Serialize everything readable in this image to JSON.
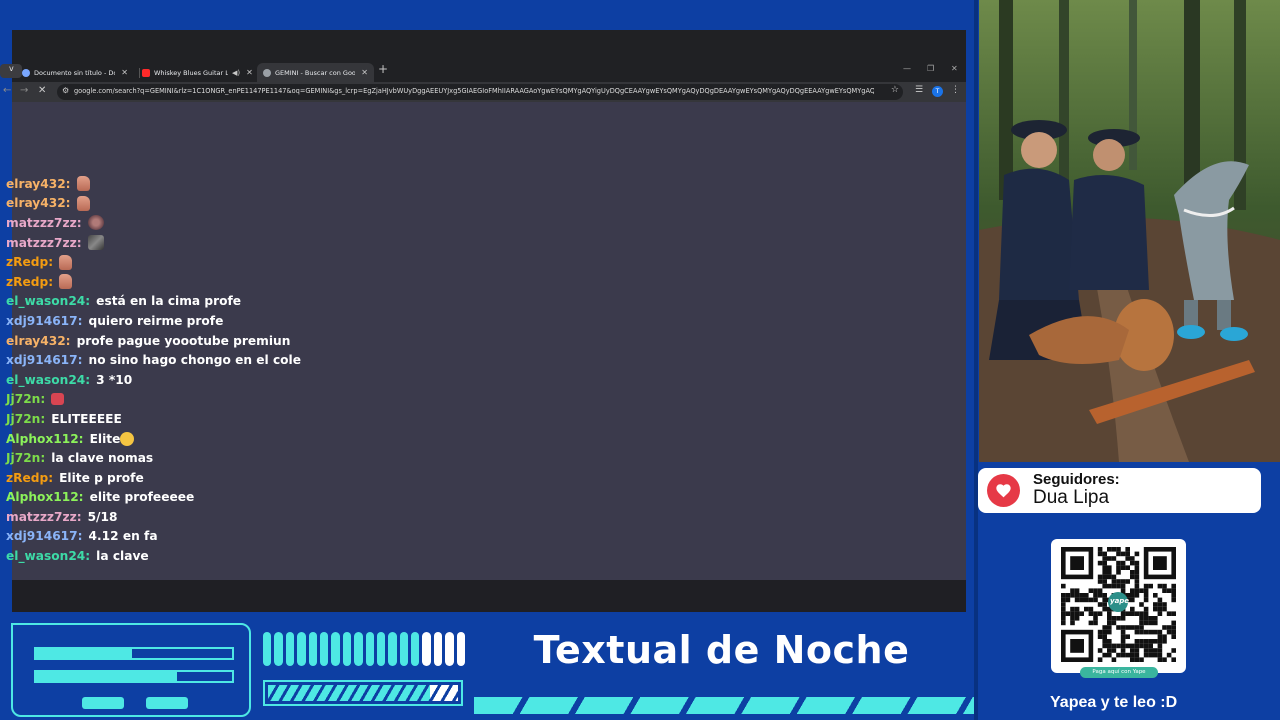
{
  "browser": {
    "sidebar_badge": "v",
    "tabs": [
      {
        "title": "Documento sin título - Docum",
        "icon_color": "#7aa7ff",
        "active": false,
        "audio": false
      },
      {
        "title": "Whiskey Blues Guitar Loun",
        "icon_color": "#ff2a2a",
        "active": false,
        "audio": true
      },
      {
        "title": "GEMINI - Buscar con Google",
        "icon_color": "#9aa0a6",
        "active": true,
        "audio": false
      }
    ],
    "new_tab": "+",
    "url": "google.com/search?q=GEMINI&rlz=1C1ONGR_enPE1147PE1147&oq=GEMINI&gs_lcrp=EgZjaHJvbWUyDggAEEUYJxg5GIAEGIoFMhIIARAAGAoYgwEYsQMYgAQYigUyDQgCEAAYgwEYsQMYgAQyDQgDEAAYgwEYsQMYgAQyDQgEEAAYgwEYsQMYgAQyDQgFEA...",
    "profile_initial": "T"
  },
  "chat": {
    "messages": [
      {
        "user": "elray432",
        "color": "#f7b267",
        "text": "",
        "emote": "thumb"
      },
      {
        "user": "elray432",
        "color": "#f7b267",
        "text": "",
        "emote": "thumb"
      },
      {
        "user": "matzzz7zz",
        "color": "#e8a8c8",
        "text": "",
        "emote": "face1"
      },
      {
        "user": "matzzz7zz",
        "color": "#e8a8c8",
        "text": "",
        "emote": "face2"
      },
      {
        "user": "zRedp",
        "color": "#f39c12",
        "text": "",
        "emote": "thumb"
      },
      {
        "user": "zRedp",
        "color": "#f39c12",
        "text": "",
        "emote": "thumb"
      },
      {
        "user": "el_wason24",
        "color": "#3ddba7",
        "text": "está en la cima profe",
        "emote": ""
      },
      {
        "user": "xdj914617",
        "color": "#8ab4f8",
        "text": "quiero reirme profe",
        "emote": ""
      },
      {
        "user": "elray432",
        "color": "#f7b267",
        "text": "profe pague yoootube premiun",
        "emote": ""
      },
      {
        "user": "xdj914617",
        "color": "#8ab4f8",
        "text": "no sino hago chongo en el cole",
        "emote": ""
      },
      {
        "user": "el_wason24",
        "color": "#3ddba7",
        "text": "3 *10",
        "emote": ""
      },
      {
        "user": "Jj72n",
        "color": "#7ddc4a",
        "text": "",
        "emote": "angry"
      },
      {
        "user": "Jj72n",
        "color": "#7ddc4a",
        "text": "ELITEEEEE",
        "emote": ""
      },
      {
        "user": "Alphox112",
        "color": "#8cf25a",
        "text": "Elite",
        "emote": "grin"
      },
      {
        "user": "Jj72n",
        "color": "#7ddc4a",
        "text": "la clave nomas",
        "emote": ""
      },
      {
        "user": "zRedp",
        "color": "#f39c12",
        "text": "Elite p profe",
        "emote": ""
      },
      {
        "user": "Alphox112",
        "color": "#8cf25a",
        "text": "elite profeeeee",
        "emote": ""
      },
      {
        "user": "matzzz7zz",
        "color": "#e8a8c8",
        "text": "5/18",
        "emote": ""
      },
      {
        "user": "xdj914617",
        "color": "#8ab4f8",
        "text": "4.12 en fa",
        "emote": ""
      },
      {
        "user": "el_wason24",
        "color": "#3ddba7",
        "text": "la clave",
        "emote": ""
      }
    ]
  },
  "followers": {
    "label": "Seguidores:",
    "name": "Dua Lipa"
  },
  "donation": {
    "qr_brand": "yape",
    "qr_caption": "Paga aquí con Yape",
    "cta": "Yapea y te leo :D"
  },
  "stream": {
    "title": "Textual de Noche"
  },
  "hud": {
    "bar1_level": 0.49,
    "bar2_level": 0.72,
    "stripe_level": 0.85,
    "segments_total": 18,
    "segments_teal": 14
  },
  "colors": {
    "accent": "#4ee8e4",
    "background": "#0d3fa3",
    "heart": "#e63946"
  }
}
